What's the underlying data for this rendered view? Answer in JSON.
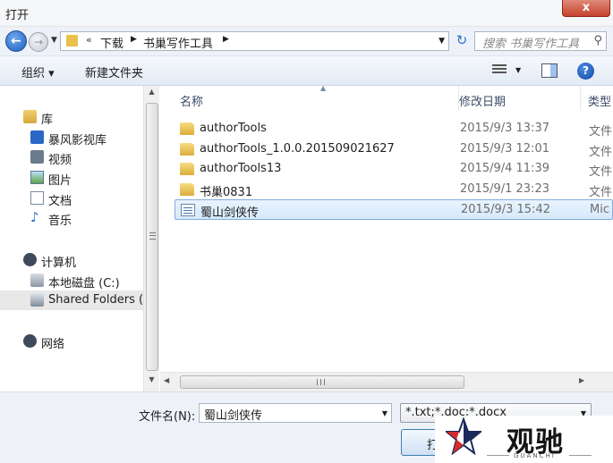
{
  "window": {
    "title": "打开",
    "close_glyph": "x"
  },
  "address": {
    "chevrons": "«",
    "crumbs": [
      "下载",
      "书巢写作工具"
    ],
    "search_placeholder": "搜索 书巢写作工具"
  },
  "toolbar": {
    "organize_label": "组织 ▾",
    "new_folder_label": "新建文件夹",
    "help_glyph": "?"
  },
  "nav": {
    "library": "库",
    "library_items": [
      "暴风影视库",
      "视频",
      "图片",
      "文档",
      "音乐"
    ],
    "computer": "计算机",
    "computer_items": [
      "本地磁盘 (C:)",
      "Shared Folders (\\"
    ],
    "network": "网络"
  },
  "columns": {
    "name": "名称",
    "modified": "修改日期",
    "type": "类型"
  },
  "files": [
    {
      "name": "authorTools",
      "date": "2015/9/3 13:37",
      "type": "文件",
      "kind": "folder"
    },
    {
      "name": "authorTools_1.0.0.201509021627",
      "date": "2015/9/3 12:01",
      "type": "文件",
      "kind": "folder"
    },
    {
      "name": "authorTools13",
      "date": "2015/9/4 11:39",
      "type": "文件",
      "kind": "folder"
    },
    {
      "name": "书巢0831",
      "date": "2015/9/1 23:23",
      "type": "文件",
      "kind": "folder"
    },
    {
      "name": "蜀山剑侠传",
      "date": "2015/9/3 15:42",
      "type": "Mic",
      "kind": "doc",
      "selected": true
    }
  ],
  "bottom": {
    "filename_label": "文件名(N):",
    "filename_value": "蜀山剑侠传",
    "filetype_value": "*.txt;*.doc;*.docx",
    "open_label": "打"
  },
  "watermark": {
    "text": "观驰",
    "sub": "GUANCHI"
  },
  "colors": {
    "accent": "#2a6fd1",
    "selection": "#d6e9fb",
    "close": "#c4422d"
  }
}
